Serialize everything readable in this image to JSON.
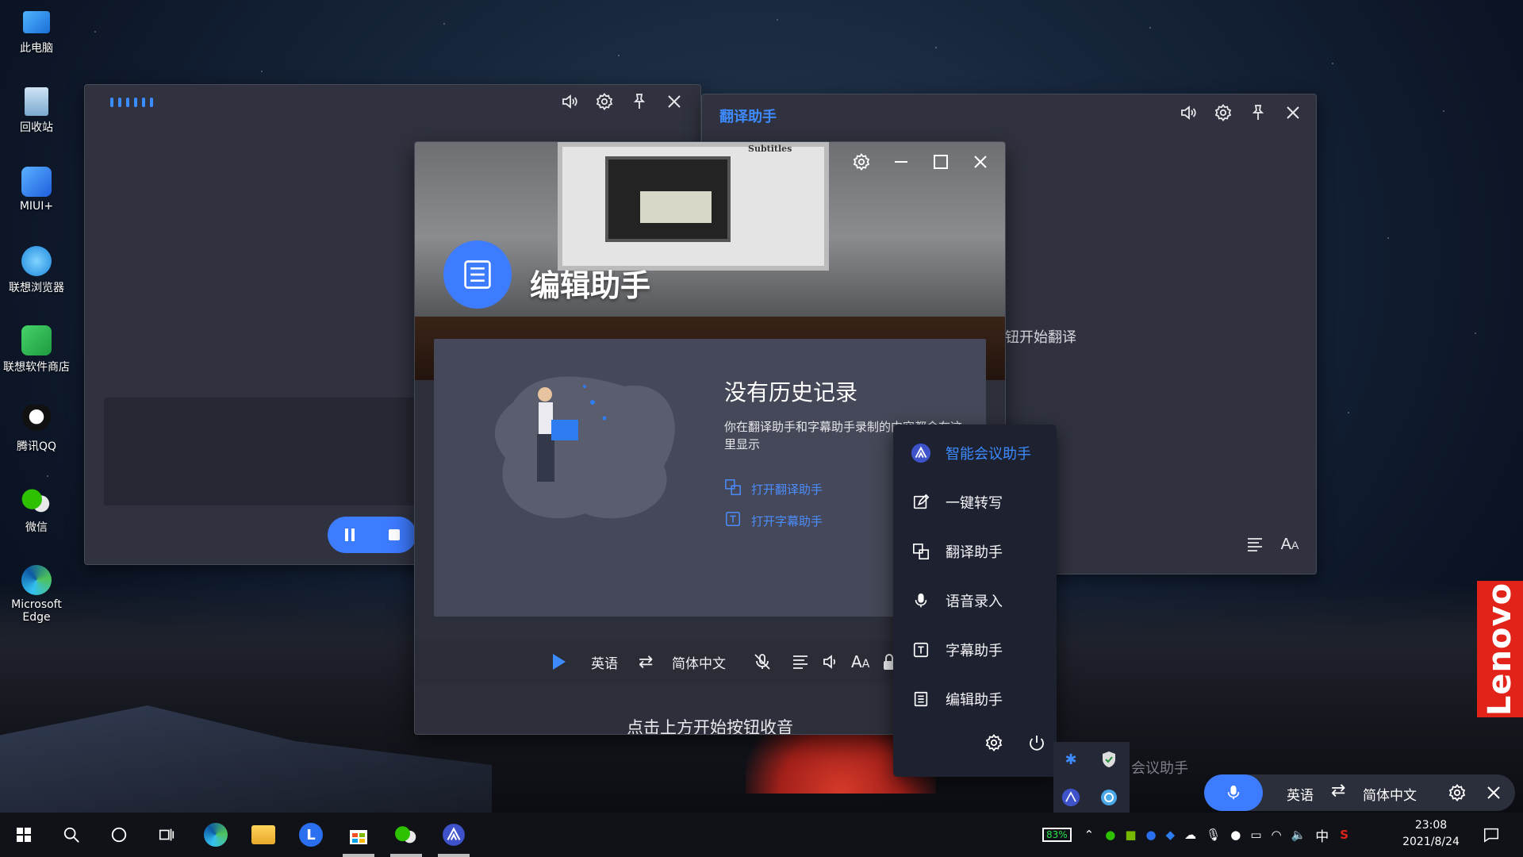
{
  "desktop_icons": [
    {
      "label": "此电脑",
      "color": "#3a8ee6"
    },
    {
      "label": "回收站",
      "color": "#6aa8d8"
    },
    {
      "label": "MIUI+",
      "color": "#2d7df0"
    },
    {
      "label": "联想浏览器",
      "color": "#2f9fe8"
    },
    {
      "label": "联想软件商店",
      "color": "#25b34b"
    },
    {
      "label": "腾讯QQ",
      "color": "#ffffff"
    },
    {
      "label": "微信",
      "color": "#2dc100"
    },
    {
      "label": "Microsoft Edge",
      "color": "#1d8fd8"
    }
  ],
  "translate_window": {
    "title": "翻译助手",
    "partial_text": "钮开始翻译"
  },
  "editor_window": {
    "title": "编辑助手",
    "banner_text": "Subtitles",
    "empty_title": "没有历史记录",
    "empty_desc": "你在翻译助手和字幕助手录制的内容都会在这里显示",
    "link_translate": "打开翻译助手",
    "link_subtitle": "打开字幕助手",
    "source_lang": "英语",
    "target_lang": "简体中文",
    "hint": "点击上方开始按钮收音"
  },
  "tray_menu": {
    "items": [
      {
        "label": "智能会议助手",
        "icon": "meeting-logo-icon",
        "active": true
      },
      {
        "label": "一键转写",
        "icon": "edit-icon"
      },
      {
        "label": "翻译助手",
        "icon": "translate-icon"
      },
      {
        "label": "语音录入",
        "icon": "microphone-icon"
      },
      {
        "label": "字幕助手",
        "icon": "subtitle-icon"
      },
      {
        "label": "编辑助手",
        "icon": "document-icon"
      }
    ]
  },
  "background_text": {
    "meeting_partial": "会议助手"
  },
  "floating_bar": {
    "source_lang": "英语",
    "target_lang": "简体中文"
  },
  "lenovo": {
    "text": "Lenovo"
  },
  "taskbar": {
    "battery": "83%",
    "ime": "中",
    "time": "23:08",
    "date": "2021/8/24"
  },
  "colors": {
    "accent": "#3d7bff",
    "link": "#4b8dff",
    "lenovo_red": "#e2231a"
  }
}
